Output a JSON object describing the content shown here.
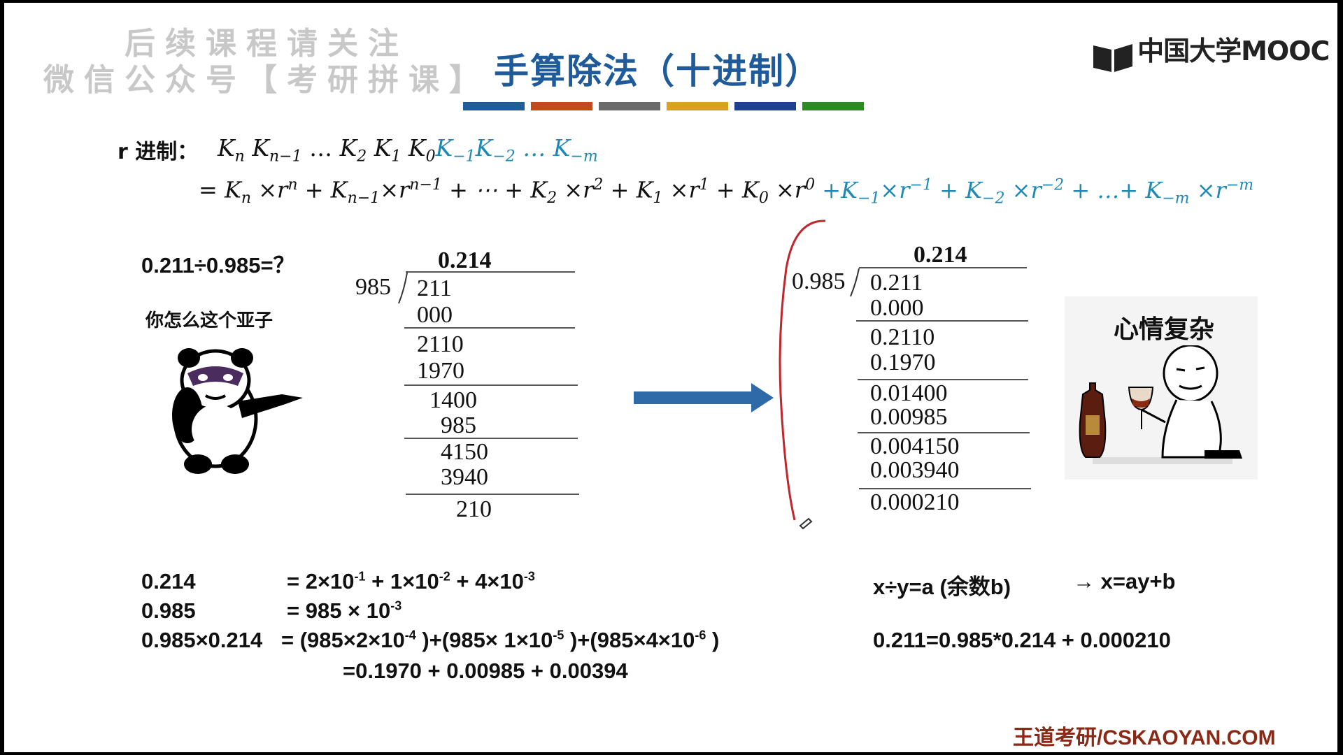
{
  "watermark": {
    "line1": "后续课程请关注",
    "line2": "微信公众号【考研拼课】"
  },
  "title": "手算除法（十进制）",
  "logo_text": "中国大学MOOC",
  "color_bars": [
    "#1f5d99",
    "#c24a1b",
    "#6b6b6b",
    "#d9a21d",
    "#1f3f8f",
    "#2e8a22"
  ],
  "radix": {
    "label": "r 进制：",
    "digits_black": [
      "K",
      "K",
      "…",
      "K",
      "K",
      "K"
    ],
    "expansion_label": "=",
    "blue_color": "#1e8ab4",
    "red_bracket_color": "#c0272d"
  },
  "left_problem": {
    "question": "0.211÷0.985=？",
    "meme_caption": "你怎么这个亚子"
  },
  "left_division": {
    "quotient": "0.214",
    "divisor": "985",
    "rows": [
      "211",
      "000",
      "2110",
      "1970",
      "1400",
      "985",
      "4150",
      "3940",
      "210"
    ]
  },
  "right_division": {
    "quotient": "0.214",
    "divisor": "0.985",
    "rows": [
      "0.211",
      "0.000",
      "0.2110",
      "0.1970",
      "0.01400",
      "0.00985",
      "0.004150",
      "0.003940",
      "0.000210"
    ]
  },
  "right_meme_caption": "心情复杂",
  "bottom": {
    "l1_left": "0.214",
    "l2_left": "0.985",
    "l3_left": "0.985×0.214",
    "l4": "=0.1970 + 0.00985 + 0.00394",
    "r1_a": "x÷y=a (余数b)",
    "r1_b": "→ x=ay+b",
    "r2": "0.211=0.985*0.214 + 0.000210"
  },
  "footer": "王道考研/CSKAOYAN.COM"
}
